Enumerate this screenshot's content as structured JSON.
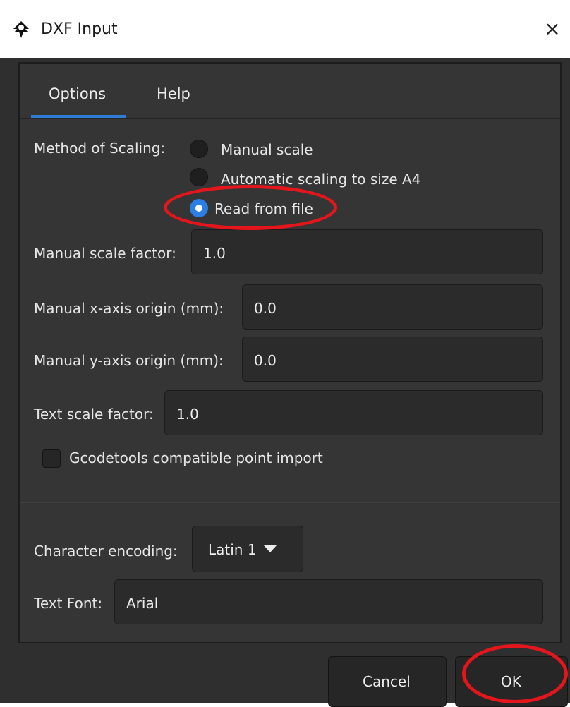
{
  "window": {
    "title": "DXF Input",
    "close_glyph": "×",
    "app_icon": "inkscape-icon"
  },
  "tabs": [
    {
      "label": "Options",
      "active": true
    },
    {
      "label": "Help",
      "active": false
    }
  ],
  "scaling": {
    "label": "Method of Scaling:",
    "options": [
      {
        "label": "Manual scale",
        "checked": false
      },
      {
        "label": "Automatic scaling to size A4",
        "checked": false
      },
      {
        "label": "Read from file",
        "checked": true
      }
    ]
  },
  "fields": {
    "manual_scale_factor": {
      "label": "Manual scale factor:",
      "value": "1.0"
    },
    "x_origin": {
      "label": "Manual x-axis origin (mm):",
      "value": "0.0"
    },
    "y_origin": {
      "label": "Manual y-axis origin (mm):",
      "value": "0.0"
    },
    "text_scale_factor": {
      "label": "Text scale factor:",
      "value": "1.0"
    }
  },
  "gcodetools": {
    "label": "Gcodetools compatible point import",
    "checked": false
  },
  "encoding": {
    "label": "Character encoding:",
    "value": "Latin 1"
  },
  "text_font": {
    "label": "Text Font:",
    "value": "Arial"
  },
  "buttons": {
    "cancel": "Cancel",
    "ok": "OK"
  },
  "colors": {
    "accent": "#2a7ee4",
    "annotation": "#e4161b",
    "background": "#2f2f2f"
  }
}
